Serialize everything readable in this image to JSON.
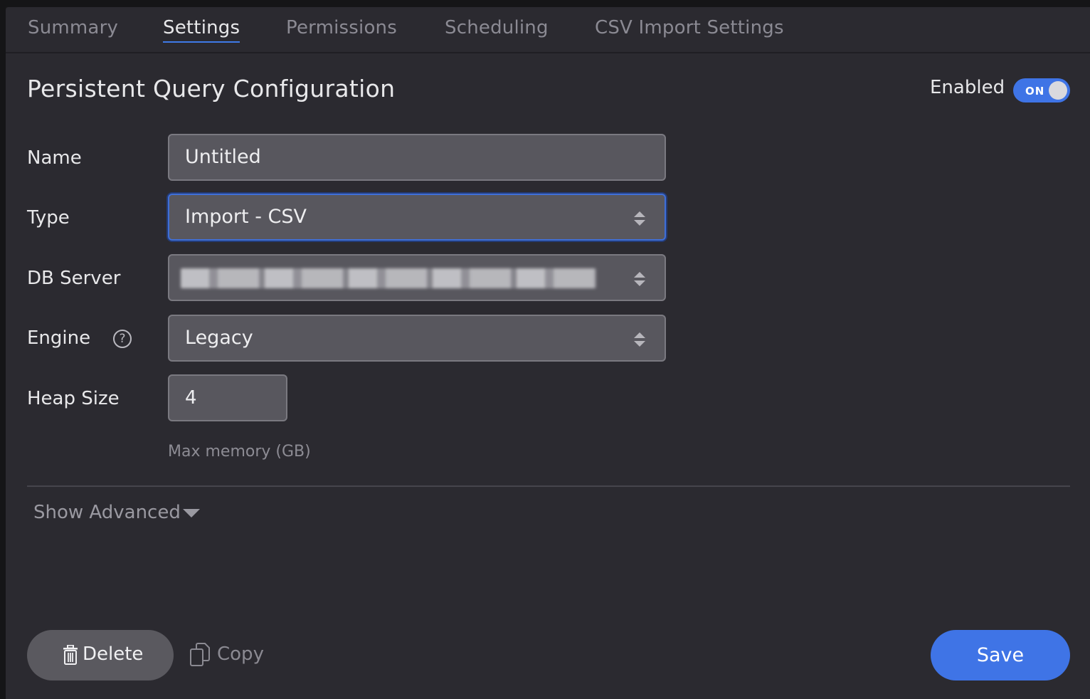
{
  "tabs": [
    {
      "label": "Summary"
    },
    {
      "label": "Settings"
    },
    {
      "label": "Permissions"
    },
    {
      "label": "Scheduling"
    },
    {
      "label": "CSV Import Settings"
    }
  ],
  "active_tab": "Settings",
  "page_title": "Persistent Query Configuration",
  "enabled": {
    "label": "Enabled",
    "toggle_text": "ON",
    "value": true
  },
  "form": {
    "name": {
      "label": "Name",
      "value": "Untitled"
    },
    "type": {
      "label": "Type",
      "value": "Import - CSV"
    },
    "db_server": {
      "label": "DB Server"
    },
    "engine": {
      "label": "Engine",
      "help_glyph": "?",
      "value": "Legacy"
    },
    "heap_size": {
      "label": "Heap Size",
      "value": "4",
      "hint": "Max memory (GB)"
    }
  },
  "advanced": {
    "label": "Show Advanced"
  },
  "actions": {
    "delete_label": "Delete",
    "copy_label": "Copy",
    "save_label": "Save"
  },
  "colors": {
    "accent": "#3f74e6",
    "panel_bg": "#2b2a30",
    "field_bg": "#58575e"
  },
  "icons": [
    "help-icon",
    "select-arrows-icon",
    "caret-down-icon",
    "trash-icon",
    "copy-icon"
  ]
}
